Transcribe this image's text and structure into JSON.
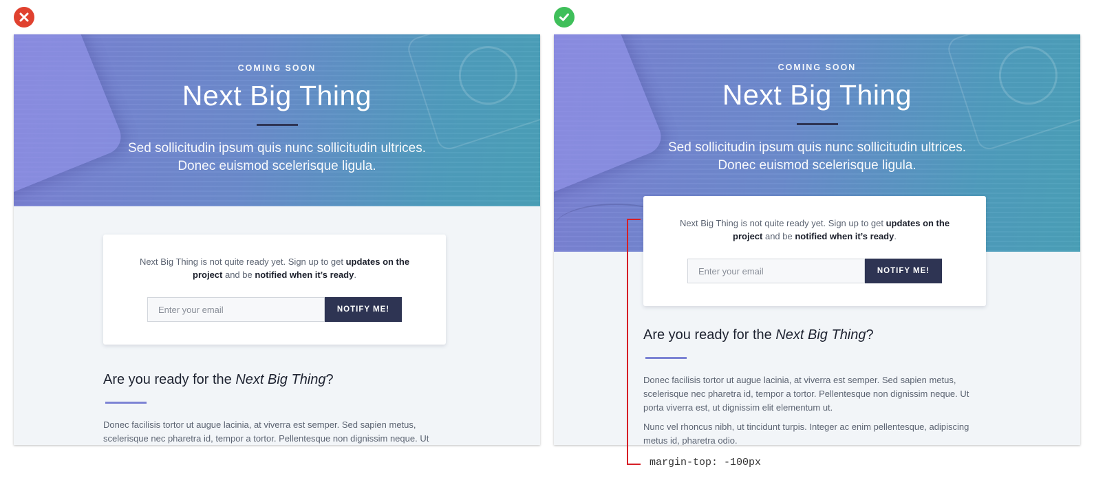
{
  "status": {
    "bad_icon": "x-circle-icon",
    "good_icon": "check-circle-icon",
    "bad_color": "#e0412f",
    "good_color": "#3fbf5a"
  },
  "hero": {
    "eyebrow": "COMING SOON",
    "title": "Next Big Thing",
    "subtitle_line1": "Sed sollicitudin ipsum quis nunc sollicitudin ultrices.",
    "subtitle_line2": "Donec euismod scelerisque ligula."
  },
  "card": {
    "text_prefix": "Next Big Thing is not quite ready yet. Sign up to get ",
    "text_bold1": "updates on the project",
    "text_mid": " and be ",
    "text_bold2": "notified when it’s ready",
    "text_suffix": ".",
    "email_placeholder": "Enter your email",
    "notify_label": "NOTIFY ME!"
  },
  "ready": {
    "heading_prefix": "Are you ready for the ",
    "heading_em": "Next Big Thing",
    "heading_suffix": "?",
    "paragraph1": "Donec facilisis tortor ut augue lacinia, at viverra est semper. Sed sapien metus, scelerisque nec pharetra id, tempor a tortor. Pellentesque non dignissim neque. Ut porta viverra est, ut dignissim elit elementum ut.",
    "paragraph2": "Nunc vel rhoncus nibh, ut tincidunt turpis. Integer ac enim pellentesque, adipiscing metus id, pharetra odio."
  },
  "annotation": {
    "label": "margin-top: -100px",
    "color": "#d61f26"
  },
  "colors": {
    "accent_dark": "#2e3453",
    "accent_rule": "#7c83d4",
    "page_bg": "#f2f5f8"
  }
}
